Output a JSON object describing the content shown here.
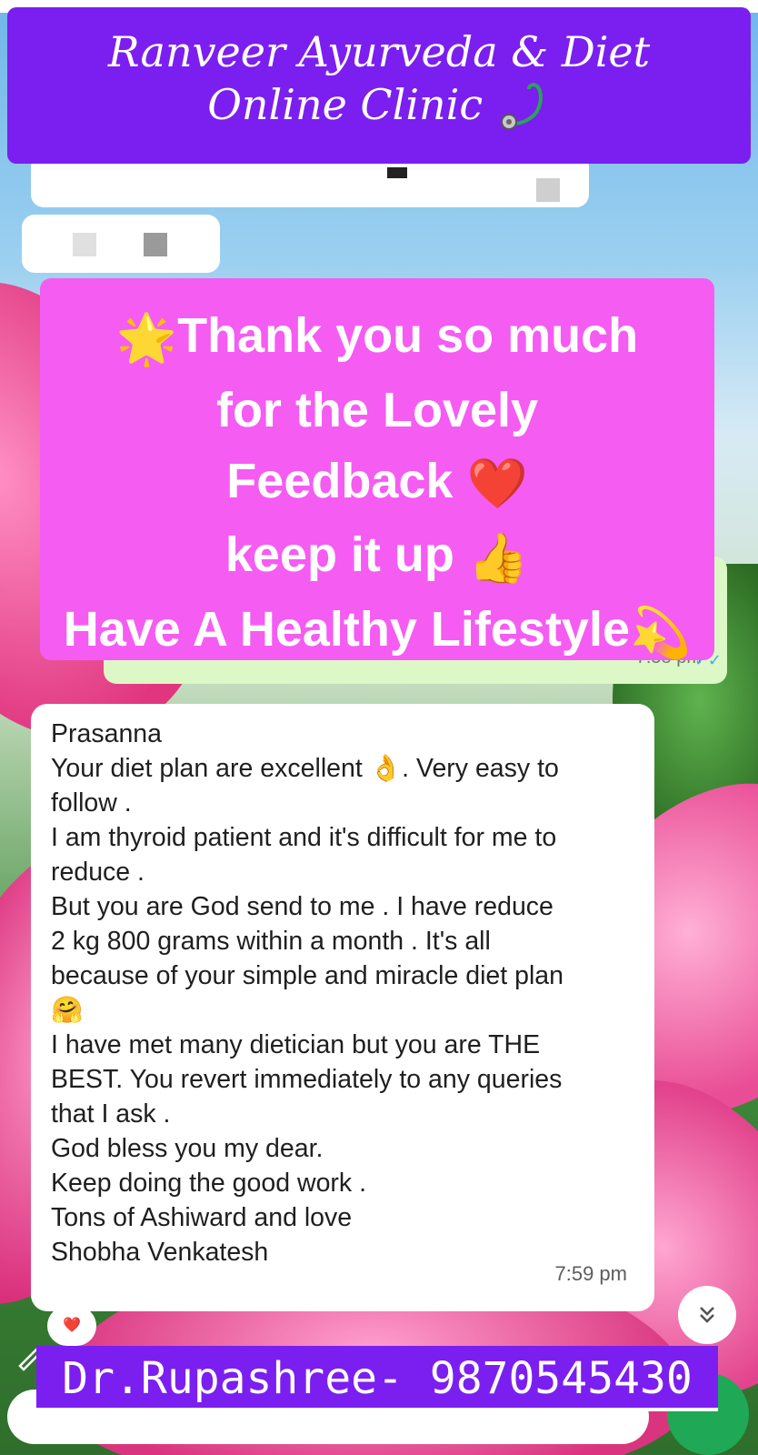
{
  "banner": {
    "line1": "Ranveer Ayurveda & Diet",
    "line2": "Online Clinic",
    "icon": "stethoscope-icon"
  },
  "feedback_card": {
    "line1": "Thank you so much",
    "line2": "for the Lovely",
    "line3": "Feedback",
    "line4": "keep it up",
    "line5": "Have A Healthy Lifestyle",
    "emoji_sparkle": "🌟",
    "emoji_heart": "❤️",
    "emoji_thumbs": "👍",
    "emoji_dizzy": "💫"
  },
  "sent_message": {
    "time": "7:58 pm"
  },
  "received_message": {
    "lines": [
      "Prasanna",
      "Your diet plan are excellent 👌.  Very easy to",
      "follow .",
      "I am thyroid patient and it's difficult for me to",
      "reduce .",
      "But you are God send to me . I have reduce",
      "2 kg 800 grams within a month . It's all",
      "because of your simple and miracle diet plan",
      "🤗",
      "I have met many dietician but you are THE",
      "BEST. You revert immediately to any queries",
      "that I ask .",
      "God bless you my dear.",
      "Keep doing the good work .",
      "Tons of Ashiward and love",
      "Shobha Venkatesh"
    ],
    "time": "7:59 pm",
    "reaction": "❤️"
  },
  "footer_banner": {
    "text": "Dr.Rupashree- 9870545430"
  },
  "colors": {
    "banner_purple": "#7a1ff0",
    "card_pink": "#f55cf2",
    "sent_green": "#dcf8c6",
    "mic_green": "#1fa855"
  }
}
